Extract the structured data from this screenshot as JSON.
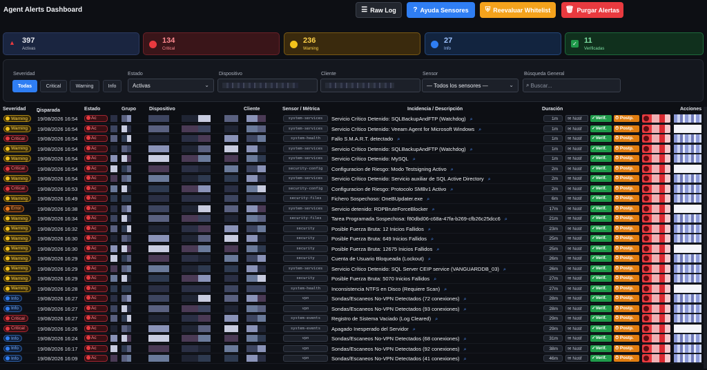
{
  "header": {
    "title": "Agent Alerts Dashboard",
    "buttons": {
      "raw_log": "Raw Log",
      "ayuda": "Ayuda Sensores",
      "reevaluar": "Reevaluar Whitelist",
      "purgar": "Purgar Alertas"
    }
  },
  "stats": [
    {
      "value": "397",
      "label": "Activas",
      "color": "#e83a3f"
    },
    {
      "value": "134",
      "label": "Critical",
      "color": "#e83a3f"
    },
    {
      "value": "236",
      "label": "Warning",
      "color": "#f2c21b"
    },
    {
      "value": "27",
      "label": "Info",
      "color": "#2f7ef3"
    },
    {
      "value": "11",
      "label": "Verificadas",
      "color": "#1f9a4a"
    }
  ],
  "filters": {
    "severidad_label": "Severidad",
    "severidad_options": [
      "Todas",
      "Critical",
      "Warning",
      "Info"
    ],
    "estado_label": "Estado",
    "estado_value": "Activas",
    "dispositivo_label": "Dispositivo",
    "cliente_label": "Cliente",
    "sensor_label": "Sensor",
    "sensor_value": "— Todos los sensores —",
    "busqueda_label": "Búsqueda General",
    "busqueda_placeholder": "Buscar..."
  },
  "table": {
    "headers": {
      "severidad": "Severidad",
      "disparada": "Disparada",
      "estado": "Estado",
      "grupo": "Grupo",
      "dispositivo": "Dispositivo",
      "cliente": "Cliente",
      "sensor": "Sensor / Métrica",
      "incidencia": "Incidencia / Descripción",
      "duracion": "Duración",
      "acciones": "Acciones"
    },
    "estado_text": "Ac",
    "notif_label": "Notif",
    "verif_label": "Verif.",
    "postp_label": "Postp.",
    "rows": [
      {
        "sev": "Warning",
        "date": "19/08/2026 16:54",
        "sensor": "system-services",
        "inc": "Servicio Crítico Detenido: SQLBackupAndFTP (Watchdog)",
        "dur": "1m"
      },
      {
        "sev": "Warning",
        "date": "19/08/2026 16:54",
        "sensor": "system-services",
        "inc": "Servicio Crítico Detenido: Veeam Agent for Microsoft Windows",
        "dur": "1m"
      },
      {
        "sev": "Critical",
        "date": "19/08/2026 16:54",
        "sensor": "system-health",
        "inc": "Fallo S.M.A.R.T. detectado",
        "dur": "1m"
      },
      {
        "sev": "Warning",
        "date": "19/08/2026 16:54",
        "sensor": "system-services",
        "inc": "Servicio Crítico Detenido: SQLBackupAndFTP (Watchdog)",
        "dur": "1m"
      },
      {
        "sev": "Warning",
        "date": "19/08/2026 16:54",
        "sensor": "system-services",
        "inc": "Servicio Crítico Detenido: MySQL",
        "dur": "1m"
      },
      {
        "sev": "Critical",
        "date": "19/08/2026 16:54",
        "sensor": "security-config",
        "inc": "Configuracion de Riesgo: Modo Testsigning Activo",
        "dur": "2m"
      },
      {
        "sev": "Warning",
        "date": "19/08/2026 16:54",
        "sensor": "system-services",
        "inc": "Servicio Crítico Detenido: Servicio auxiliar de SQL Active Directory",
        "dur": "2m"
      },
      {
        "sev": "Critical",
        "date": "19/08/2026 16:53",
        "sensor": "security-config",
        "inc": "Configuracion de Riesgo: Protocolo SMBv1 Activo",
        "dur": "2m"
      },
      {
        "sev": "Warning",
        "date": "19/08/2026 16:49",
        "sensor": "security-files",
        "inc": "Fichero Sospechoso: OneBUpdater.exe",
        "dur": "6m"
      },
      {
        "sev": "Error",
        "date": "19/08/2026 16:38",
        "sensor": "system-services",
        "inc": "Servicio detenido: RDPBruteForceBlocker",
        "dur": "17m"
      },
      {
        "sev": "Warning",
        "date": "19/08/2026 16:34",
        "sensor": "security-files",
        "inc": "Tarea Programada Sospechosa: f80dbd06-c68a-47fa-b269-cfb26c25dcc6",
        "dur": "21m"
      },
      {
        "sev": "Warning",
        "date": "19/08/2026 16:32",
        "sensor": "security",
        "inc": "Posible Fuerza Bruta: 12 Inicios Fallidos",
        "dur": "23m"
      },
      {
        "sev": "Warning",
        "date": "19/08/2026 16:30",
        "sensor": "security",
        "inc": "Posible Fuerza Bruta: 649 Inicios Fallidos",
        "dur": "25m"
      },
      {
        "sev": "Warning",
        "date": "19/08/2026 16:30",
        "sensor": "security",
        "inc": "Posible Fuerza Bruta: 12675 Inicios Fallidos",
        "dur": "25m"
      },
      {
        "sev": "Warning",
        "date": "19/08/2026 16:29",
        "sensor": "security",
        "inc": "Cuenta de Usuario Bloqueada (Lockout)",
        "dur": "26m"
      },
      {
        "sev": "Warning",
        "date": "19/08/2026 16:29",
        "sensor": "system-services",
        "inc": "Servicio Crítico Detenido: SQL Server CEIP service (VANGUARDDB_03)",
        "dur": "26m"
      },
      {
        "sev": "Warning",
        "date": "19/08/2026 16:29",
        "sensor": "security",
        "inc": "Posible Fuerza Bruta: 5070 Inicios Fallidos",
        "dur": "27m"
      },
      {
        "sev": "Warning",
        "date": "19/08/2026 16:28",
        "sensor": "system-health",
        "inc": "Inconsistencia NTFS en Disco (Requiere Scan)",
        "dur": "27m"
      },
      {
        "sev": "Info",
        "date": "19/08/2026 16:27",
        "sensor": "vpn",
        "inc": "Sondas/Escaneos No-VPN Detectados (72 conexiones)",
        "dur": "28m"
      },
      {
        "sev": "Info",
        "date": "19/08/2026 16:27",
        "sensor": "vpn",
        "inc": "Sondas/Escaneos No-VPN Detectados (93 conexiones)",
        "dur": "28m"
      },
      {
        "sev": "Critical",
        "date": "19/08/2026 16:27",
        "sensor": "system-events",
        "inc": "Registro de Sistema Vaciado (Log Cleared)",
        "dur": "29m"
      },
      {
        "sev": "Critical",
        "date": "19/08/2026 16:26",
        "sensor": "system-events",
        "inc": "Apagado Inesperado del Servidor",
        "dur": "29m"
      },
      {
        "sev": "Info",
        "date": "19/08/2026 16:24",
        "sensor": "vpn",
        "inc": "Sondas/Escaneos No-VPN Detectados (68 conexiones)",
        "dur": "31m"
      },
      {
        "sev": "Info",
        "date": "19/08/2026 16:17",
        "sensor": "vpn",
        "inc": "Sondas/Escaneos No-VPN Detectados (92 conexiones)",
        "dur": "38m"
      },
      {
        "sev": "Info",
        "date": "19/08/2026 16:09",
        "sensor": "vpn",
        "inc": "Sondas/Escaneos No-VPN Detectados (41 conexiones)",
        "dur": "46m"
      }
    ]
  }
}
